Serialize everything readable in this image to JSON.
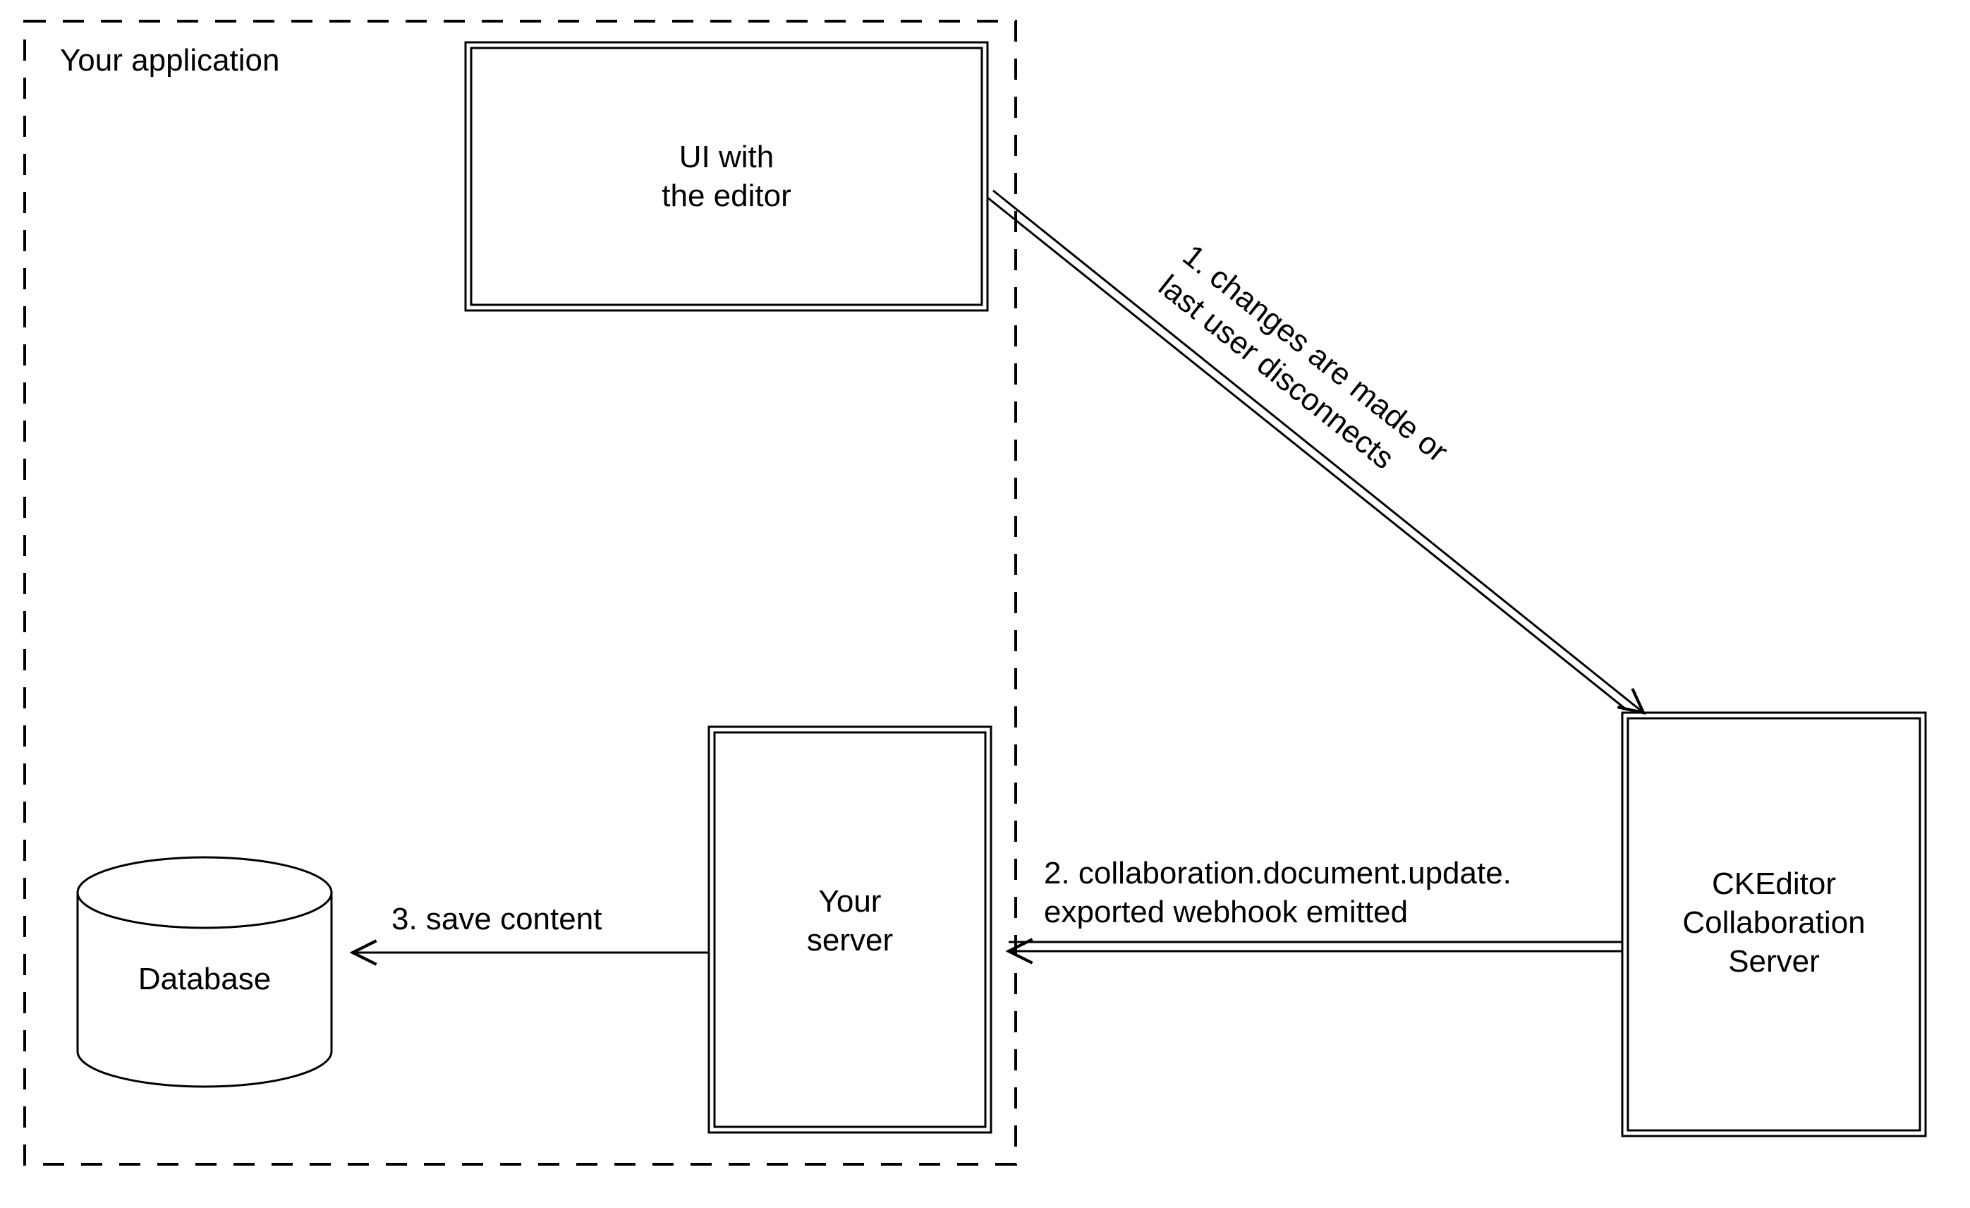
{
  "container_label": "Your application",
  "nodes": {
    "ui_editor": "UI with\nthe editor",
    "your_server": "Your\nserver",
    "database": "Database",
    "ckeditor_server": "CKEditor\nCollaboration\nServer"
  },
  "edges": {
    "step1": "1. changes are made or\nlast user disconnects",
    "step2": "2. collaboration.document.update.\nexported webhook emitted",
    "step3": "3. save content"
  }
}
